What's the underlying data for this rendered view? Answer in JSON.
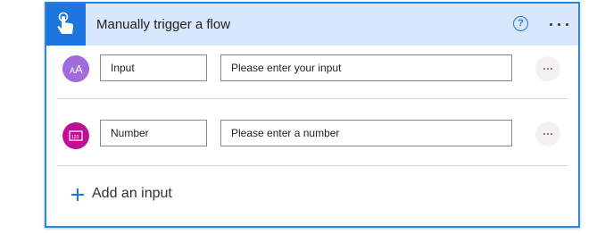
{
  "header": {
    "title": "Manually trigger a flow",
    "trigger_icon": "hand-touch-icon",
    "help_icon": "question-circle-icon",
    "help_glyph": "?",
    "more_icon": "ellipsis-icon",
    "accent": "#1d76de",
    "background": "#d8e7fb"
  },
  "inputs": [
    {
      "icon": "text-type-icon",
      "icon_glyph": "AA",
      "icon_color": "#a26bdc",
      "name": "Input",
      "placeholder": "Please enter your input"
    },
    {
      "icon": "number-type-icon",
      "icon_glyph": "123",
      "icon_color": "#c10f94",
      "name": "Number",
      "placeholder": "Please enter a number"
    }
  ],
  "add_input": {
    "label": "Add an input",
    "icon": "plus-icon"
  }
}
